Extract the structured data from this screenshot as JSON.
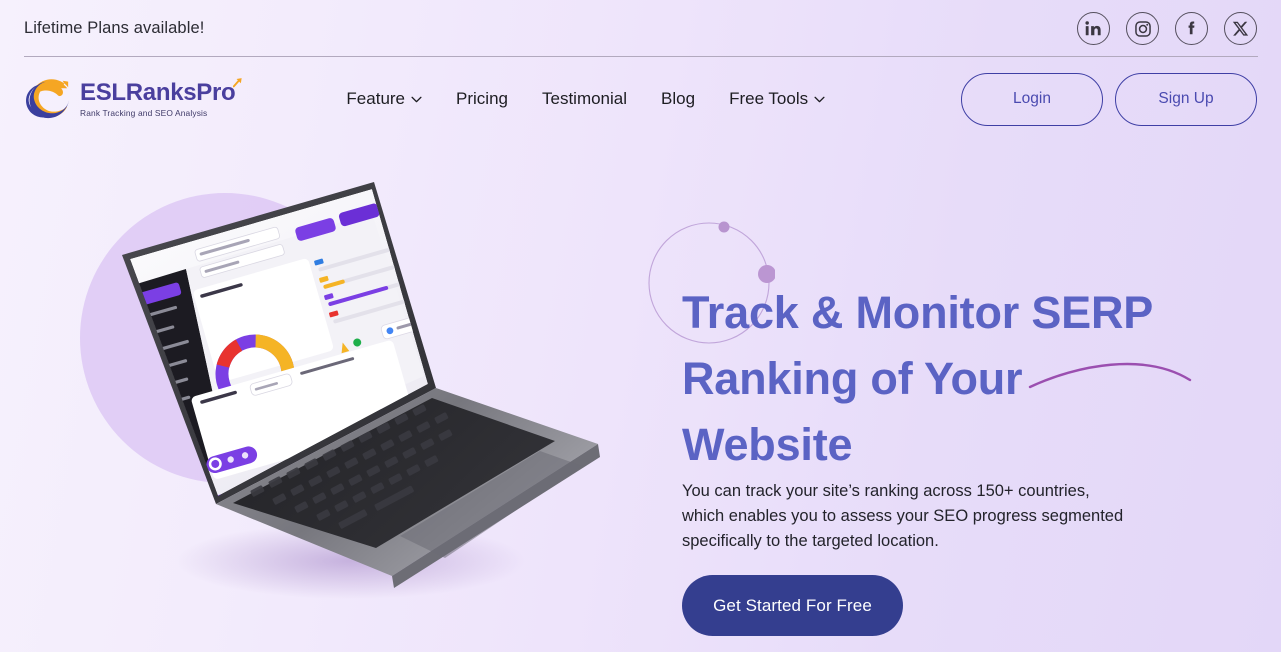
{
  "topbar": {
    "announcement": "Lifetime Plans available!",
    "social": [
      {
        "name": "linkedin-icon",
        "label": "LinkedIn"
      },
      {
        "name": "instagram-icon",
        "label": "Instagram"
      },
      {
        "name": "facebook-icon",
        "label": "Facebook"
      },
      {
        "name": "x-twitter-icon",
        "label": "X"
      }
    ]
  },
  "header": {
    "logo": {
      "title": "ESLRanksPro",
      "tagline": "Rank Tracking and SEO Analysis",
      "mark_colors": {
        "orange": "#f5a623",
        "blue": "#3a3f9e"
      }
    },
    "nav": [
      {
        "label": "Feature",
        "has_dropdown": true
      },
      {
        "label": "Pricing",
        "has_dropdown": false
      },
      {
        "label": "Testimonial",
        "has_dropdown": false
      },
      {
        "label": "Blog",
        "has_dropdown": false
      },
      {
        "label": "Free Tools",
        "has_dropdown": true
      }
    ],
    "login_label": "Login",
    "signup_label": "Sign Up"
  },
  "hero": {
    "headline": "Track & Monitor SERP Ranking of Your Website",
    "subtext": "You can track your site’s ranking across 150+ countries, which enables you to assess your SEO progress segmented specifically to the targeted location.",
    "cta_label": "Get Started For Free",
    "image_alt": "laptop-dashboard-mockup"
  },
  "colors": {
    "headline": "#5b63c4",
    "cta_background": "#343e8f",
    "cta_text": "#ffffff",
    "outline_button_border": "#3f3fa5",
    "page_background_start": "#f6f1fd",
    "page_background_end": "#e3d7f8",
    "blob": "#ddc8f4",
    "swoosh": "#9b4fb0"
  }
}
